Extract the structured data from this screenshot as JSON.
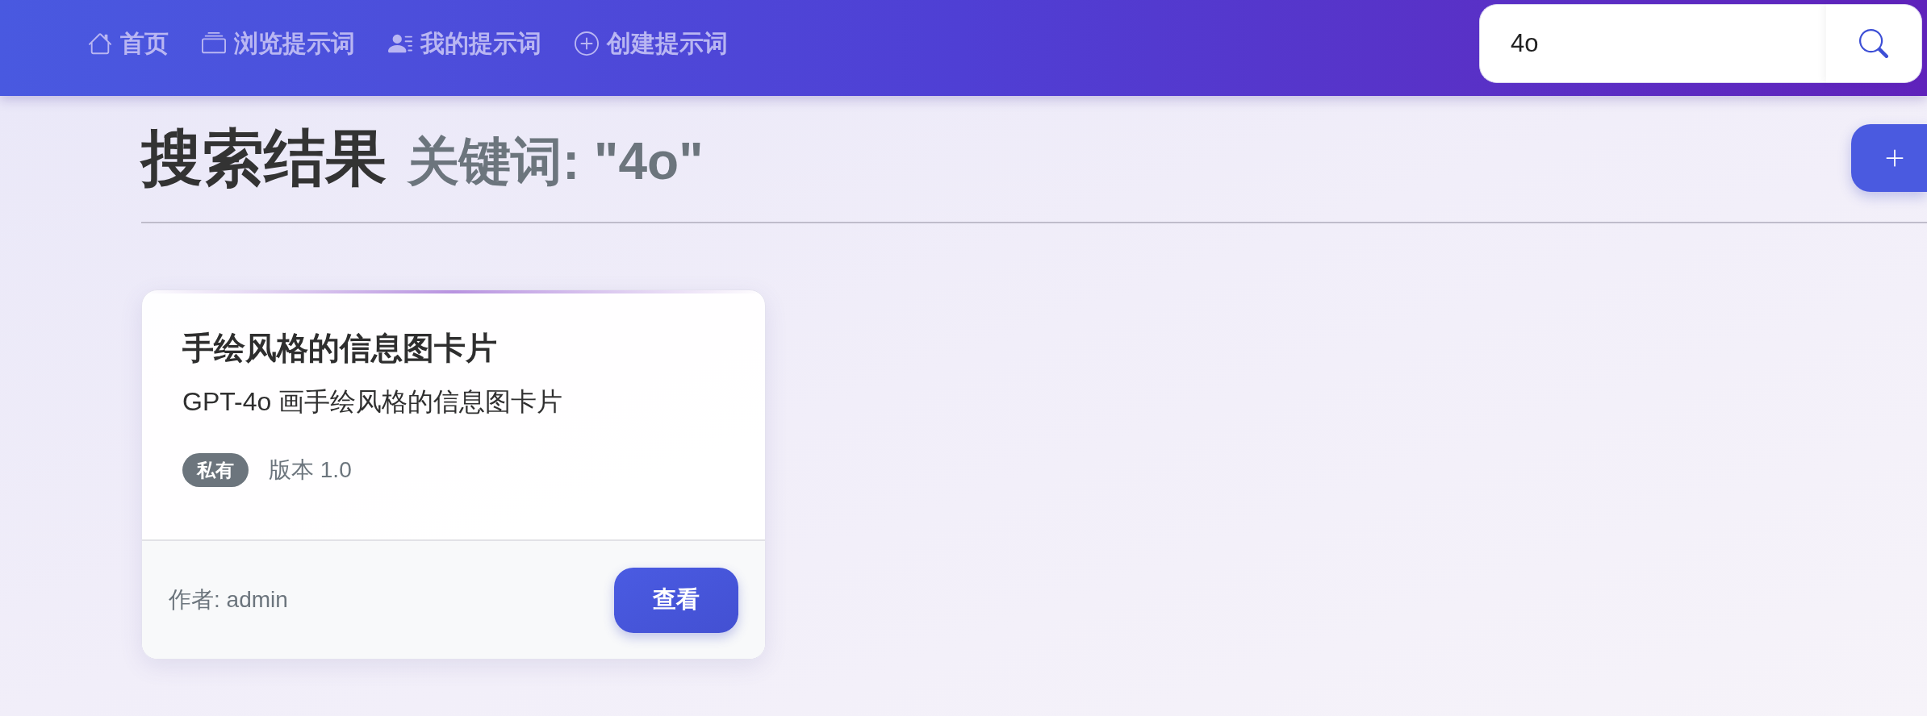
{
  "nav": {
    "items": [
      {
        "label": "首页",
        "selected": false
      },
      {
        "label": "浏览提示词",
        "selected": false
      },
      {
        "label": "我的提示词",
        "selected": false
      },
      {
        "label": "创建提示词",
        "selected": false
      }
    ]
  },
  "search": {
    "value": "4o"
  },
  "header": {
    "title": "搜索结果",
    "subtitle": "关键词: \"4o\""
  },
  "results": [
    {
      "title": "手绘风格的信息图卡片",
      "description": "GPT-4o 画手绘风格的信息图卡片",
      "badge": "私有",
      "version": "版本 1.0",
      "author": "作者: admin",
      "action": "查看"
    }
  ]
}
